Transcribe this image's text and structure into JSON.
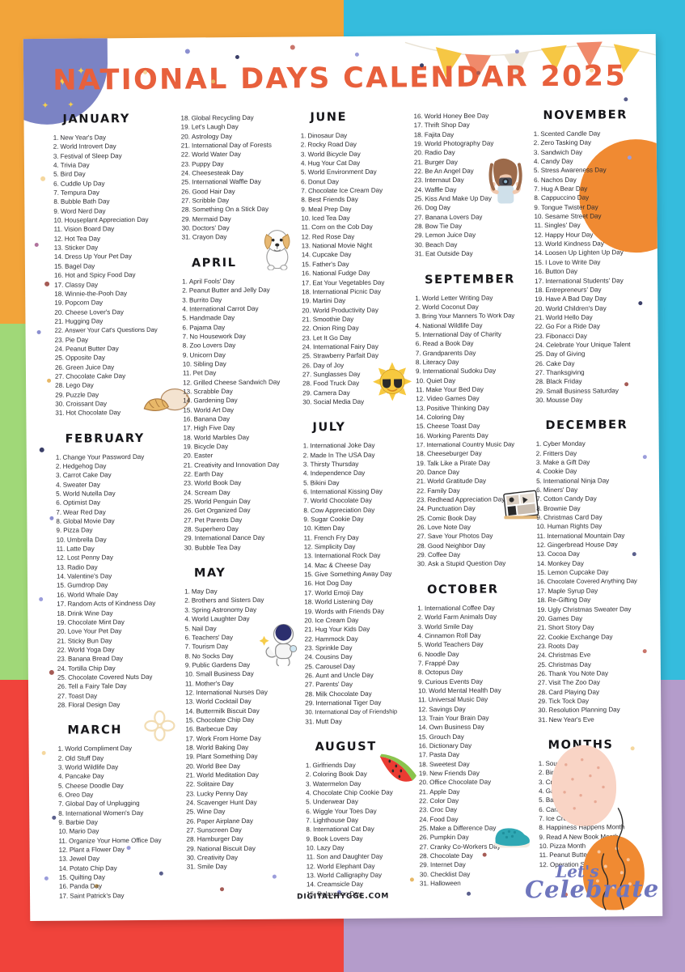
{
  "title": "NATIONAL DAYS CALENDAR 2025",
  "footer_url": "DIGITALHYGGE.COM",
  "celebrate": {
    "line1": "Let's",
    "line2": "Celebrate"
  },
  "palette": {
    "title_orange": "#e8603c",
    "bg_orange": "#f2a43a",
    "bg_cyan": "#35bcdd",
    "bg_green": "#a0d878",
    "bg_teal": "#35bcdd",
    "bg_red": "#f0433b",
    "bg_purple": "#b49ccb",
    "moon_blue": "#7b83c4",
    "circle_orange": "#f08a32",
    "script_purple": "#6f76bd"
  },
  "months": [
    {
      "name": "JANUARY",
      "days": [
        "New Year's Day",
        "World Introvert Day",
        "Festival of Sleep Day",
        "Trivia Day",
        "Bird Day",
        "Cuddle Up Day",
        "Tempura Day",
        "Bubble Bath Day",
        "Word Nerd Day",
        "Houseplant Appreciation Day",
        "Vision Board Day",
        "Hot Tea Day",
        "Sticker Day",
        "Dress Up Your Pet Day",
        "Bagel Day",
        "Hot and Spicy Food Day",
        "Classy Day",
        "Winnie-the-Pooh Day",
        "Popcorn Day",
        "Cheese Lover's Day",
        "Hugging Day",
        "Answer Your Cat's Questions Day",
        "Pie Day",
        "Peanut Butter Day",
        "Opposite Day",
        "Green Juice Day",
        "Chocolate Cake Day",
        "Lego Day",
        "Puzzle Day",
        "Croissant Day",
        "Hot Chocolate Day"
      ]
    },
    {
      "name": "FEBRUARY",
      "days": [
        "Change Your Password Day",
        "Hedgehog Day",
        "Carrot Cake Day",
        "Sweater Day",
        "World Nutella Day",
        "Optimist Day",
        "Wear Red Day",
        "Global Movie Day",
        "Pizza Day",
        "Umbrella Day",
        "Latte Day",
        "Lost Penny Day",
        "Radio Day",
        "Valentine's Day",
        "Gumdrop Day",
        "World Whale Day",
        "Random Acts of Kindness Day",
        "Drink Wine Day",
        "Chocolate Mint Day",
        "Love Your Pet Day",
        "Sticky Bun Day",
        "World Yoga Day",
        "Banana Bread Day",
        "Tortilla Chip Day",
        "Chocolate Covered Nuts Day",
        "Tell a Fairy Tale Day",
        "Toast Day",
        "Floral Design Day"
      ]
    },
    {
      "name": "MARCH",
      "days": [
        "World Compliment Day",
        "Old Stuff Day",
        "World Wildlife Day",
        "Pancake Day",
        "Cheese Doodle Day",
        "Oreo Day",
        "Global Day of Unplugging",
        "International Women's Day",
        "Barbie Day",
        "Mario Day",
        "Organize Your Home Office Day",
        "Plant a Flower Day",
        "Jewel Day",
        "Potato Chip Day",
        "Quilting Day",
        "Panda Day",
        "Saint Patrick's Day",
        "Global Recycling Day",
        "Let's Laugh Day",
        "Astrology Day",
        "International Day of Forests",
        "World Water Day",
        "Puppy Day",
        "Cheesesteak Day",
        "International Waffle Day",
        "Good Hair Day",
        "Scribble Day",
        "Something On a Stick Day",
        "Mermaid Day",
        "Doctors' Day",
        "Crayon Day"
      ]
    },
    {
      "name": "APRIL",
      "days": [
        "April Fools' Day",
        "Peanut Butter and Jelly Day",
        "Burrito Day",
        "International Carrot Day",
        "Handmade Day",
        "Pajama Day",
        "No Housework Day",
        "Zoo Lovers Day",
        "Unicorn Day",
        "Sibling Day",
        "Pet Day",
        "Grilled Cheese Sandwich Day",
        "Scrabble Day",
        "Gardening Day",
        "World Art Day",
        "Banana Day",
        "High Five Day",
        "World Marbles Day",
        "Bicycle Day",
        "Easter",
        "Creativity and Innovation Day",
        "Earth Day",
        "World Book Day",
        "Scream Day",
        "World Penguin Day",
        "Get Organized Day",
        "Pet Parents Day",
        "Superhero Day",
        "International Dance Day",
        "Bubble Tea Day"
      ]
    },
    {
      "name": "MAY",
      "days": [
        "May Day",
        "Brothers and Sisters Day",
        "Spring Astronomy Day",
        "World Laughter Day",
        "Nail Day",
        "Teachers' Day",
        "Tourism Day",
        "No Socks Day",
        "Public Gardens Day",
        "Small Business Day",
        "Mother's Day",
        "International Nurses Day",
        "World Cocktail Day",
        "Buttermilk Biscuit Day",
        "Chocolate Chip Day",
        "Barbecue Day",
        "Work From Home Day",
        "World Baking Day",
        "Plant Something Day",
        "World Bee Day",
        "World Meditation Day",
        "Solitaire Day",
        "Lucky Penny Day",
        "Scavenger Hunt Day",
        "Wine Day",
        "Paper Airplane Day",
        "Sunscreen Day",
        "Hamburger Day",
        "National Biscuit Day",
        "Creativity Day",
        "Smile Day"
      ]
    },
    {
      "name": "JUNE",
      "days": [
        "Dinosaur Day",
        "Rocky Road Day",
        "World Bicycle Day",
        "Hug Your Cat Day",
        "World Environment Day",
        "Donut Day",
        "Chocolate Ice Cream Day",
        "Best Friends Day",
        "Meal Prep Day",
        "Iced Tea Day",
        "Corn on the Cob Day",
        "Red Rose Day",
        "National Movie Night",
        "Cupcake Day",
        "Father's Day",
        "National Fudge Day",
        "Eat Your Vegetables Day",
        "International Picnic Day",
        "Martini Day",
        "World Productivity Day",
        "Smoothie Day",
        "Onion Ring Day",
        "Let It Go Day",
        "International Fairy Day",
        "Strawberry Parfait Day",
        "Day of Joy",
        "Sunglasses Day",
        "Food Truck Day",
        "Camera Day",
        "Social Media Day"
      ]
    },
    {
      "name": "JULY",
      "days": [
        "International Joke Day",
        "Made In The USA Day",
        "Thirsty Thursday",
        "Independence Day",
        "Bikini Day",
        "International Kissing Day",
        "World Chocolate Day",
        "Cow Appreciation Day",
        "Sugar Cookie Day",
        "Kitten Day",
        "French Fry Day",
        "Simplicity Day",
        "International Rock Day",
        "Mac & Cheese Day",
        "Give Something Away Day",
        "Hot Dog Day",
        "World Emoji Day",
        "World Listening Day",
        "Words with Friends Day",
        "Ice Cream Day",
        "Hug Your Kids Day",
        "Hammock Day",
        "Sprinkle Day",
        "Cousins Day",
        "Carousel Day",
        "Aunt and Uncle Day",
        "Parents' Day",
        "Milk Chocolate Day",
        "International Tiger Day",
        "International Day of Friendship",
        "Mutt Day"
      ]
    },
    {
      "name": "AUGUST",
      "days": [
        "Girlfriends Day",
        "Coloring Book Day",
        "Watermelon Day",
        "Chocolate Chip Cookie Day",
        "Underwear Day",
        "Wiggle Your Toes Day",
        "Lighthouse Day",
        "International Cat Day",
        "Book Lovers Day",
        "Lazy Day",
        "Son and Daughter Day",
        "World Elephant Day",
        "World Calligraphy Day",
        "Creamsicle Day",
        "Relaxation Day",
        "World Honey Bee Day",
        "Thrift Shop Day",
        "Fajita Day",
        "World Photography Day",
        "Radio Day",
        "Burger Day",
        "Be An Angel Day",
        "Internaut Day",
        "Waffle Day",
        "Kiss And Make Up Day",
        "Dog Day",
        "Banana Lovers Day",
        "Bow Tie Day",
        "Lemon Juice Day",
        "Beach Day",
        "Eat Outside Day"
      ]
    },
    {
      "name": "SEPTEMBER",
      "days": [
        "World Letter Writing Day",
        "World Coconut Day",
        "Bring Your Manners To Work Day",
        "National Wildlife Day",
        "International Day of Charity",
        "Read a Book Day",
        "Grandparents Day",
        "Literacy Day",
        "International Sudoku Day",
        "Quiet Day",
        "Make Your Bed Day",
        "Video Games Day",
        "Positive Thinking Day",
        "Coloring Day",
        "Cheese Toast Day",
        "Working Parents Day",
        "International Country Music Day",
        "Cheeseburger Day",
        "Talk Like a Pirate Day",
        "Dance Day",
        "World Gratitude Day",
        "Family Day",
        "Redhead Appreciation Day",
        "Punctuation Day",
        "Comic Book Day",
        "Love Note Day",
        "Save Your Photos Day",
        "Good Neighbor Day",
        "Coffee Day",
        "Ask a Stupid Question Day"
      ]
    },
    {
      "name": "OCTOBER",
      "days": [
        "International Coffee Day",
        "World Farm Animals Day",
        "World Smile Day",
        "Cinnamon Roll Day",
        "World Teachers Day",
        "Noodle Day",
        "Frappé Day",
        "Octopus Day",
        "Curious Events Day",
        "World Mental Health Day",
        "Universal Music Day",
        "Savings Day",
        "Train Your Brain Day",
        "Own Business Day",
        "Grouch Day",
        "Dictionary Day",
        "Pasta Day",
        "Sweetest Day",
        "New Friends Day",
        "Office Chocolate Day",
        "Apple Day",
        "Color Day",
        "Croc Day",
        "Food Day",
        "Make a Difference Day",
        "Pumpkin Day",
        "Cranky Co-Workers Day",
        "Chocolate Day",
        "Internet Day",
        "Checklist Day",
        "Halloween"
      ]
    },
    {
      "name": "NOVEMBER",
      "days": [
        "Scented Candle Day",
        "Zero Tasking Day",
        "Sandwich Day",
        "Candy Day",
        "Stress Awareness Day",
        "Nachos Day",
        "Hug A Bear Day",
        "Cappuccino Day",
        "Tongue Twister Day",
        "Sesame Street Day",
        "Singles' Day",
        "Happy Hour Day",
        "World Kindness Day",
        "Loosen Up Lighten Up Day",
        "I Love to Write Day",
        "Button Day",
        "International Students' Day",
        "Entrepreneurs' Day",
        "Have A Bad Day Day",
        "World Children's Day",
        "World Hello Day",
        "Go For a Ride Day",
        "Fibonacci Day",
        "Celebrate Your Unique Talent",
        "Day of Giving",
        "Cake Day",
        "Thanksgiving",
        "Black Friday",
        "Small Business Saturday",
        "Mousse Day"
      ]
    },
    {
      "name": "DECEMBER",
      "days": [
        "Cyber Monday",
        "Fritters Day",
        "Make a Gift Day",
        "Cookie Day",
        "International Ninja Day",
        "Miners' Day",
        "Cotton Candy Day",
        "Brownie Day",
        "Christmas Card Day",
        "Human Rights Day",
        "International Mountain Day",
        "Gingerbread House Day",
        "Cocoa Day",
        "Monkey Day",
        "Lemon Cupcake Day",
        "Chocolate Covered Anything Day",
        "Maple Syrup Day",
        "Re-Gifting Day",
        "Ugly Christmas Sweater Day",
        "Games Day",
        "Short Story Day",
        "Cookie Exchange Day",
        "Roots Day",
        "Christmas Eve",
        "Christmas Day",
        "Thank You Note Day",
        "Visit The Zoo Day",
        "Card Playing Day",
        "Tick Tock Day",
        "Resolution Planning Day",
        "New Year's Eve"
      ]
    },
    {
      "name": "MONTHS",
      "days": [
        "Soup Month",
        "Bird Feeding Month",
        "Craft Month",
        "Garden Month",
        "Barbecue Month",
        "Candy Month",
        "Ice Cream Month",
        "Happiness Happens Month",
        "Read A New Book Month",
        "Pizza Month",
        "Peanut Butter Lovers Month",
        "Operation Santa Paws"
      ]
    }
  ],
  "doodles": [
    {
      "name": "croissant-coffee-doodle",
      "glyph": "☕"
    },
    {
      "name": "flower-doodle",
      "glyph": "✿"
    },
    {
      "name": "puppy-doodle",
      "glyph": "🐶"
    },
    {
      "name": "astronaut-doodle",
      "glyph": "🚀"
    },
    {
      "name": "sun-sunglasses-doodle",
      "glyph": "☀"
    },
    {
      "name": "watermelon-doodle",
      "glyph": "🍉"
    },
    {
      "name": "photographer-doodle",
      "glyph": "📷"
    },
    {
      "name": "comic-book-doodle",
      "glyph": "📰"
    },
    {
      "name": "croc-shoe-doodle",
      "glyph": "👟"
    }
  ]
}
